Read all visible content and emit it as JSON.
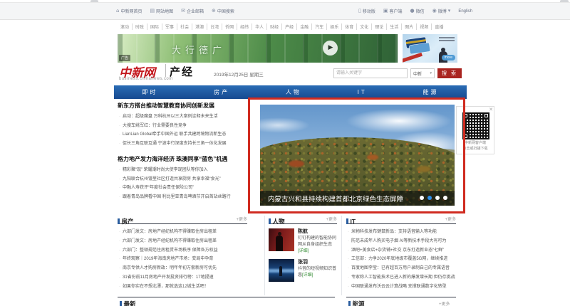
{
  "icons": {
    "home": "⌂",
    "sitemap": "▤",
    "mail": "✉",
    "globe": "⊕",
    "mobile": "▯",
    "app": "▣",
    "wechat": "●",
    "weibo": "◉",
    "caret": "▾",
    "play": "▶",
    "close": "✕"
  },
  "utility_bar": {
    "left": [
      "中新网首页",
      "网站地图",
      "企业邮箱",
      "中国搜索"
    ],
    "right": [
      "移动版",
      "客户端",
      "微信",
      "微博",
      "English"
    ]
  },
  "category_nav": {
    "items": [
      "滚动",
      "时政",
      "国际",
      "军事",
      "社会",
      "港澳",
      "台湾",
      "侨网",
      "经纬",
      "华人",
      "财经",
      "产经",
      "金融",
      "汽车",
      "娱乐",
      "体育",
      "文化",
      "理论",
      "生活",
      "图片",
      "视频",
      "直播"
    ]
  },
  "banner_ad": {
    "text": "大行德广",
    "tag": "广告"
  },
  "side_ad": {
    "more": "more"
  },
  "masthead": {
    "brand": "中新网",
    "channel": "产经",
    "domain": "business.chinanews.com",
    "date": "2019年12月25日 星期三",
    "search": {
      "placeholder": "请输入关键字",
      "scope": "中新",
      "button": "搜 索"
    }
  },
  "main_nav": {
    "items": [
      "即时",
      "房产",
      "人物",
      "IT",
      "能源"
    ]
  },
  "news": {
    "group1": {
      "title": "新东方搭台推动智慧教育协同创新发展",
      "items": [
        "启动：超级魔盘 万科杭州以三大案例诠释未来生活",
        "大搜车姚军红：行业需要良性竞争",
        "LianLian Global牵手中国外运 联手共建跨境物流新生态",
        "促长三角互联互通 宁波中行深度支持长三角一体化发展"
      ]
    },
    "group2": {
      "title": "格力地产发力海洋经济 珠澳同享“蓝色”机遇",
      "items": [
        "精彩聚“现” 荣耀潮时尚大使李现团队等你加入",
        "九阳联合杭州馒里社区打造共享厨房 共享幸福“食光”",
        "中融人寿获评“年度社会责任保险公司”",
        "跟着青岛品牌看中国 利比里亚青岛啤酒节开启首站丝路行"
      ]
    }
  },
  "carousel": {
    "caption": "内蒙古兴和县持续构建首都北京绿色生态屏障",
    "active_dot_index": 1,
    "dot_count": 4
  },
  "qr_widget": {
    "line1": "中新网客户端",
    "line2": "点击或扫描下载"
  },
  "sections": {
    "fangchan": {
      "title": "房产",
      "more": "+更多",
      "items": [
        "六部门发文：房地产经纪机构不得赚取住房出租差",
        "六部门发文：房地产经纪机构不得赚取住房出租差",
        "六部门：整顿规范住房租赁市场秩序 保障各方权益",
        "年终观察｜2019年海南房地产市场：变局中孕育",
        "南京专供人才购房新政：明年年初万套新房可优先",
        "31省份前11月房地产开发投资排行榜：17地提速",
        "如果你实在不想北漂，那就选这12城生活吧！"
      ]
    },
    "renwu": {
      "title": "人物",
      "more": "+更多",
      "people": [
        {
          "name": "陈航",
          "desc": "钉钉构建的智能协同网从自身组织生态",
          "detail": "[详细]"
        },
        {
          "name": "张羽",
          "desc": "抖音的短视频知识普惠",
          "detail": "[详细]"
        }
      ]
    },
    "it": {
      "title": "IT",
      "more": "+更多",
      "items": [
        "米物科技发布键鼠新品：支持语音输入等功能",
        "防范未成年人购买电子烟 AI等新技术手段大有可为",
        "酒吧+美食店+杂货铺+社交 京东打造新业态“七鲜”",
        "工信部：力争2020年底地级市覆盖5G网，继续推进",
        "百度地图李莹：已有超百万用户录制自己的专属语音",
        "专家称人工智能技术已进入新的爆发增长期 但仍存挑战",
        "中国联通发布沃云云计算战略 支撑联通数字化转型"
      ]
    },
    "zuixin": {
      "title": "最新"
    },
    "nengyuan": {
      "title": "能源",
      "more": "+更多"
    }
  }
}
